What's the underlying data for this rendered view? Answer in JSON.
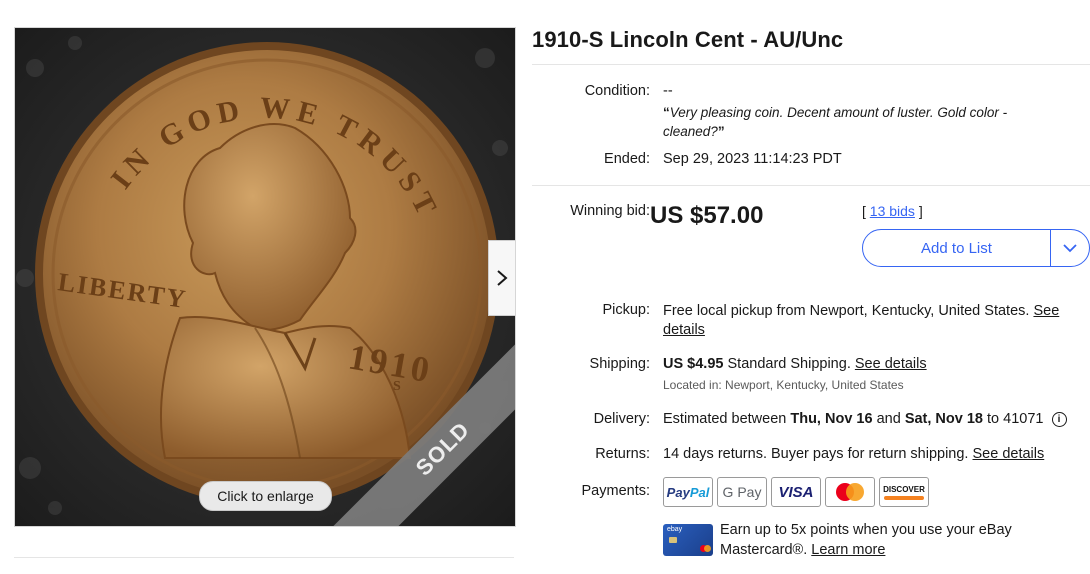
{
  "listing": {
    "title": "1910-S Lincoln Cent - AU/Unc",
    "condition_label": "Condition:",
    "condition_value": "--",
    "seller_note": "Very pleasing coin. Decent amount of luster. Gold color - cleaned?",
    "ended_label": "Ended:",
    "ended_value": "Sep 29, 2023 11:14:23 PDT"
  },
  "image": {
    "sold_label": "SOLD",
    "enlarge_label": "Click to enlarge",
    "coin_text": {
      "motto": "IN GOD WE TRUST",
      "liberty": "LIBERTY",
      "year": "1910",
      "mint": "S"
    }
  },
  "bid": {
    "label": "Winning bid:",
    "price": "US $57.00",
    "bids_link": "13 bids",
    "add_to_list": "Add to List"
  },
  "pickup": {
    "label": "Pickup:",
    "text": "Free local pickup from Newport, Kentucky, United States.",
    "link": "See details"
  },
  "shipping": {
    "label": "Shipping:",
    "price": "US $4.95",
    "method": "Standard Shipping.",
    "link": "See details",
    "located": "Located in: Newport, Kentucky, United States"
  },
  "delivery": {
    "label": "Delivery:",
    "prefix": "Estimated between",
    "start": "Thu, Nov 16",
    "and": "and",
    "end": "Sat, Nov 18",
    "to": "to 41071"
  },
  "returns": {
    "label": "Returns:",
    "text": "14 days returns. Buyer pays for return shipping.",
    "link": "See details"
  },
  "payments": {
    "label": "Payments:",
    "methods": [
      "PayPal",
      "G Pay",
      "VISA",
      "Mastercard",
      "DISCOVER"
    ],
    "card_brand": "ebay",
    "promo_text": "Earn up to 5x points when you use your eBay Mastercard®.",
    "promo_link": "Learn more"
  },
  "colors": {
    "link_blue": "#3665f3",
    "text": "#191919",
    "sold_ribbon": "#7d7d7d"
  }
}
